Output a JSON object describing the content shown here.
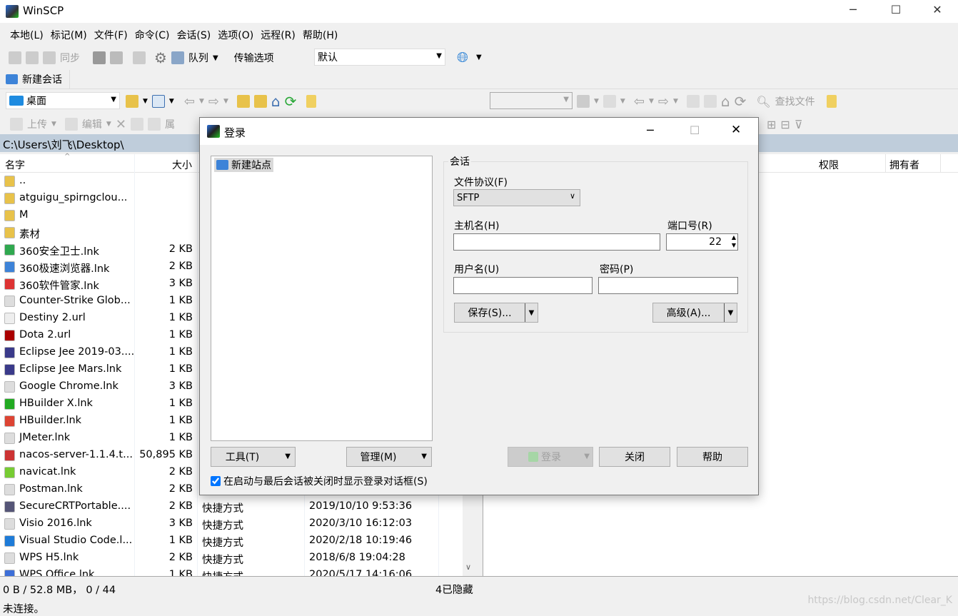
{
  "app": {
    "title": "WinSCP"
  },
  "menu": [
    "本地(L)",
    "标记(M)",
    "文件(F)",
    "命令(C)",
    "会话(S)",
    "选项(O)",
    "远程(R)",
    "帮助(H)"
  ],
  "toolbar": {
    "sync": "同步",
    "queue": "队列",
    "transfer_label": "传输选项",
    "transfer_value": "默认"
  },
  "session_tab": "新建会话",
  "local": {
    "location": "桌面",
    "upload": "上传",
    "edit": "编辑",
    "props": "属",
    "path": "C:\\Users\\刘飞\\Desktop\\",
    "columns": [
      "名字",
      "大小"
    ],
    "files": [
      {
        "name": "..",
        "size": "",
        "type": "",
        "date": ""
      },
      {
        "name": "atguigu_spirngclou...",
        "size": "",
        "type": "",
        "date": ""
      },
      {
        "name": "M",
        "size": "",
        "type": "",
        "date": ""
      },
      {
        "name": "素材",
        "size": "",
        "type": "",
        "date": ""
      },
      {
        "name": "360安全卫士.lnk",
        "size": "2 KB",
        "type": "",
        "date": ""
      },
      {
        "name": "360极速浏览器.lnk",
        "size": "2 KB",
        "type": "",
        "date": ""
      },
      {
        "name": "360软件管家.lnk",
        "size": "3 KB",
        "type": "",
        "date": ""
      },
      {
        "name": "Counter-Strike Glob...",
        "size": "1 KB",
        "type": "",
        "date": ""
      },
      {
        "name": "Destiny 2.url",
        "size": "1 KB",
        "type": "",
        "date": ""
      },
      {
        "name": "Dota 2.url",
        "size": "1 KB",
        "type": "",
        "date": ""
      },
      {
        "name": "Eclipse Jee 2019-03....",
        "size": "1 KB",
        "type": "",
        "date": ""
      },
      {
        "name": "Eclipse Jee Mars.lnk",
        "size": "1 KB",
        "type": "",
        "date": ""
      },
      {
        "name": "Google Chrome.lnk",
        "size": "3 KB",
        "type": "",
        "date": ""
      },
      {
        "name": "HBuilder X.lnk",
        "size": "1 KB",
        "type": "",
        "date": ""
      },
      {
        "name": "HBuilder.lnk",
        "size": "1 KB",
        "type": "",
        "date": ""
      },
      {
        "name": "JMeter.lnk",
        "size": "1 KB",
        "type": "",
        "date": ""
      },
      {
        "name": "nacos-server-1.1.4.t...",
        "size": "50,895 KB",
        "type": "",
        "date": ""
      },
      {
        "name": "navicat.lnk",
        "size": "2 KB",
        "type": "",
        "date": ""
      },
      {
        "name": "Postman.lnk",
        "size": "2 KB",
        "type": "",
        "date": ""
      },
      {
        "name": "SecureCRTPortable....",
        "size": "2 KB",
        "type": "快捷方式",
        "date": "2019/10/10  9:53:36"
      },
      {
        "name": "Visio 2016.lnk",
        "size": "3 KB",
        "type": "快捷方式",
        "date": "2020/3/10  16:12:03"
      },
      {
        "name": "Visual Studio Code.l...",
        "size": "1 KB",
        "type": "快捷方式",
        "date": "2020/2/18  10:19:46"
      },
      {
        "name": "WPS H5.lnk",
        "size": "2 KB",
        "type": "快捷方式",
        "date": "2018/6/8  19:04:28"
      },
      {
        "name": "WPS Office.lnk",
        "size": "1 KB",
        "type": "快捷方式",
        "date": "2020/5/17  14:16:06"
      }
    ]
  },
  "remote": {
    "find": "查找文件",
    "columns": [
      "权限",
      "拥有者"
    ]
  },
  "status": {
    "selection": "0 B / 52.8 MB，  0 / 44",
    "hidden": "4已隐藏",
    "connection": "未连接。"
  },
  "dialog": {
    "title": "登录",
    "site": "新建站点",
    "group": "会话",
    "protocol_label": "文件协议(F)",
    "protocol": "SFTP",
    "host_label": "主机名(H)",
    "host": "",
    "port_label": "端口号(R)",
    "port": "22",
    "user_label": "用户名(U)",
    "user": "",
    "pass_label": "密码(P)",
    "pass": "",
    "save": "保存(S)...",
    "advanced": "高级(A)...",
    "tools": "工具(T)",
    "manage": "管理(M)",
    "login": "登录",
    "close": "关闭",
    "help": "帮助",
    "show_on_start": "在启动与最后会话被关闭时显示登录对话框(S)",
    "show_on_start_checked": true
  },
  "watermark": "https://blog.csdn.net/Clear_K"
}
